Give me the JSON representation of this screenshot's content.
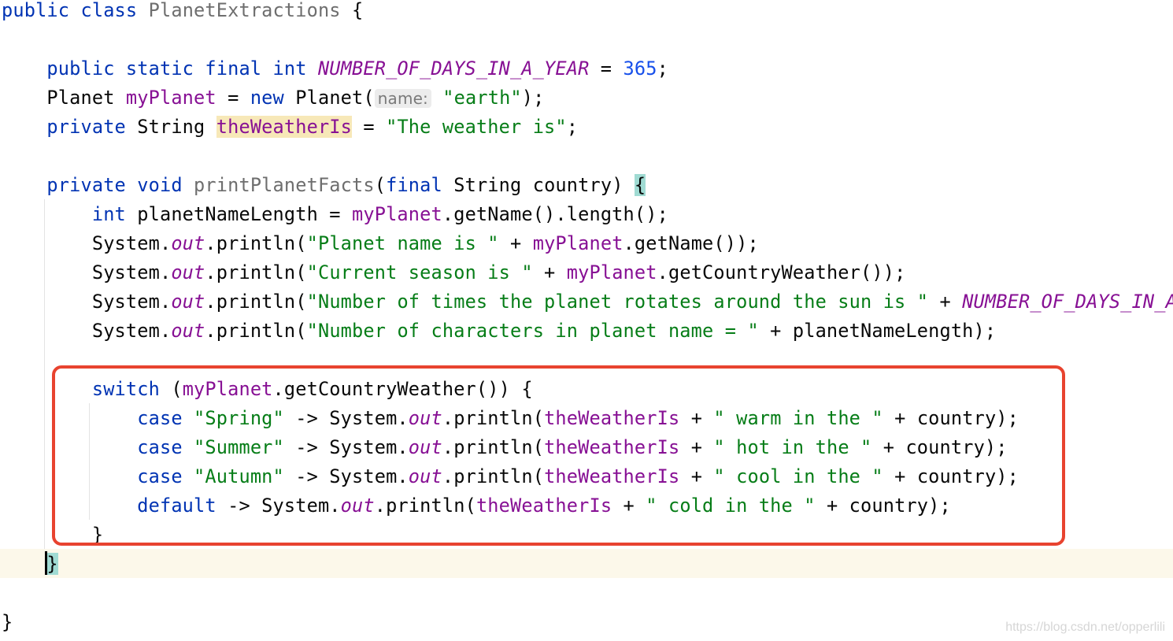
{
  "editor": {
    "language": "Java",
    "colors": {
      "keyword": "#0033b3",
      "string": "#067d17",
      "field": "#871094",
      "number": "#1750eb",
      "annotation_box": "#e8432f",
      "current_line": "#fcf8ea"
    },
    "lines": [
      [
        [
          "k",
          "public class "
        ],
        [
          "g",
          "PlanetExtractions"
        ],
        [
          "p",
          " {"
        ]
      ],
      [],
      [
        [
          "p",
          "    "
        ],
        [
          "k",
          "public static final int "
        ],
        [
          "fi",
          "NUMBER_OF_DAYS_IN_A_YEAR"
        ],
        [
          "p",
          " = "
        ],
        [
          "n",
          "365"
        ],
        [
          "p",
          ";"
        ]
      ],
      [
        [
          "p",
          "    Planet "
        ],
        [
          "f",
          "myPlanet"
        ],
        [
          "p",
          " = "
        ],
        [
          "k",
          "new "
        ],
        [
          "p",
          "Planet("
        ],
        [
          "h",
          "name:"
        ],
        [
          "s",
          " \"earth\""
        ],
        [
          "p",
          ");"
        ]
      ],
      [
        [
          "p",
          "    "
        ],
        [
          "k",
          "private "
        ],
        [
          "p",
          "String "
        ],
        [
          "hl",
          "theWeatherIs"
        ],
        [
          "p",
          " = "
        ],
        [
          "s",
          "\"The weather is\""
        ],
        [
          "p",
          ";"
        ]
      ],
      [],
      [
        [
          "p",
          "    "
        ],
        [
          "k",
          "private void "
        ],
        [
          "g",
          "printPlanetFacts"
        ],
        [
          "p",
          "("
        ],
        [
          "k",
          "final "
        ],
        [
          "p",
          "String country) "
        ],
        [
          "br",
          "{"
        ]
      ],
      [
        [
          "p",
          "        "
        ],
        [
          "k",
          "int "
        ],
        [
          "p",
          "planetNameLength = "
        ],
        [
          "f",
          "myPlanet"
        ],
        [
          "p",
          ".getName().length();"
        ]
      ],
      [
        [
          "p",
          "        System."
        ],
        [
          "fi",
          "out"
        ],
        [
          "p",
          ".println("
        ],
        [
          "s",
          "\"Planet name is \""
        ],
        [
          "p",
          " + "
        ],
        [
          "f",
          "myPlanet"
        ],
        [
          "p",
          ".getName());"
        ]
      ],
      [
        [
          "p",
          "        System."
        ],
        [
          "fi",
          "out"
        ],
        [
          "p",
          ".println("
        ],
        [
          "s",
          "\"Current season is \""
        ],
        [
          "p",
          " + "
        ],
        [
          "f",
          "myPlanet"
        ],
        [
          "p",
          ".getCountryWeather());"
        ]
      ],
      [
        [
          "p",
          "        System."
        ],
        [
          "fi",
          "out"
        ],
        [
          "p",
          ".println("
        ],
        [
          "s",
          "\"Number of times the planet rotates around the sun is \""
        ],
        [
          "p",
          " + "
        ],
        [
          "fi",
          "NUMBER_OF_DAYS_IN_A_"
        ]
      ],
      [
        [
          "p",
          "        System."
        ],
        [
          "fi",
          "out"
        ],
        [
          "p",
          ".println("
        ],
        [
          "s",
          "\"Number of characters in planet name = \""
        ],
        [
          "p",
          " + planetNameLength);"
        ]
      ],
      [],
      [
        [
          "p",
          "        "
        ],
        [
          "k",
          "switch "
        ],
        [
          "p",
          "("
        ],
        [
          "f",
          "myPlanet"
        ],
        [
          "p",
          ".getCountryWeather()) {"
        ]
      ],
      [
        [
          "p",
          "            "
        ],
        [
          "k",
          "case "
        ],
        [
          "s",
          "\"Spring\""
        ],
        [
          "p",
          " -> System."
        ],
        [
          "fi",
          "out"
        ],
        [
          "p",
          ".println("
        ],
        [
          "f",
          "theWeatherIs"
        ],
        [
          "p",
          " + "
        ],
        [
          "s",
          "\" warm in the \""
        ],
        [
          "p",
          " + country);"
        ]
      ],
      [
        [
          "p",
          "            "
        ],
        [
          "k",
          "case "
        ],
        [
          "s",
          "\"Summer\""
        ],
        [
          "p",
          " -> System."
        ],
        [
          "fi",
          "out"
        ],
        [
          "p",
          ".println("
        ],
        [
          "f",
          "theWeatherIs"
        ],
        [
          "p",
          " + "
        ],
        [
          "s",
          "\" hot in the \""
        ],
        [
          "p",
          " + country);"
        ]
      ],
      [
        [
          "p",
          "            "
        ],
        [
          "k",
          "case "
        ],
        [
          "s",
          "\"Autumn\""
        ],
        [
          "p",
          " -> System."
        ],
        [
          "fi",
          "out"
        ],
        [
          "p",
          ".println("
        ],
        [
          "f",
          "theWeatherIs"
        ],
        [
          "p",
          " + "
        ],
        [
          "s",
          "\" cool in the \""
        ],
        [
          "p",
          " + country);"
        ]
      ],
      [
        [
          "p",
          "            "
        ],
        [
          "k",
          "default "
        ],
        [
          "p",
          "-> System."
        ],
        [
          "fi",
          "out"
        ],
        [
          "p",
          ".println("
        ],
        [
          "f",
          "theWeatherIs"
        ],
        [
          "p",
          " + "
        ],
        [
          "s",
          "\" cold in the \""
        ],
        [
          "p",
          " + country);"
        ]
      ],
      [
        [
          "p",
          "        }"
        ]
      ],
      [
        [
          "p",
          "    "
        ],
        [
          "br",
          "}"
        ]
      ],
      [],
      [
        [
          "p",
          "}"
        ]
      ]
    ]
  },
  "watermark": "https://blog.csdn.net/opperlili"
}
